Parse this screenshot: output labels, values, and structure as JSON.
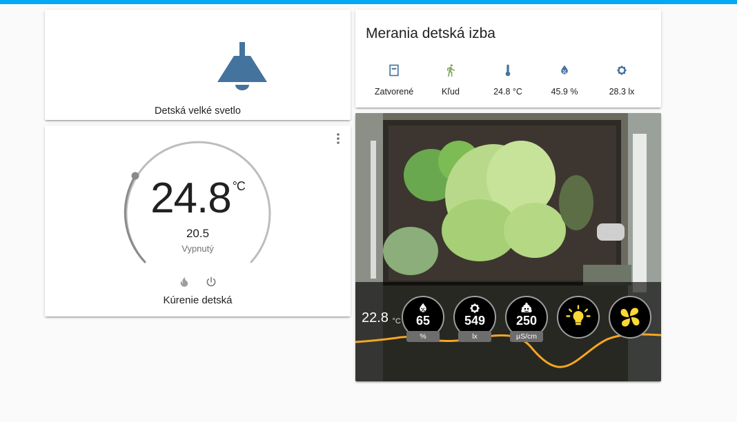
{
  "colors": {
    "accent": "#03a9f4",
    "icon_blue": "#44739e",
    "plant_orange": "#f5a623"
  },
  "light": {
    "name": "Detská velké svetlo",
    "icon": "ceiling-lamp-icon"
  },
  "thermostat": {
    "current": "24.8",
    "unit": "°C",
    "target": "20.5",
    "mode": "Vypnutý",
    "name": "Kúrenie detská",
    "menu_icon": "dots-vertical-icon",
    "controls": [
      "fire-icon",
      "power-icon"
    ]
  },
  "measurements": {
    "title": "Merania detská izba",
    "items": [
      {
        "icon": "door-closed-icon",
        "value": "Zatvorené"
      },
      {
        "icon": "walk-icon",
        "value": "Kľud"
      },
      {
        "icon": "thermometer-icon",
        "value": "24.8 °C"
      },
      {
        "icon": "water-percent-icon",
        "value": "45.9 %"
      },
      {
        "icon": "brightness-icon",
        "value": "28.3 lx"
      }
    ]
  },
  "plant": {
    "temperature": "22.8",
    "temperature_unit": "°C",
    "gauges": [
      {
        "icon": "water-percent-icon",
        "value": "65",
        "unit": "%"
      },
      {
        "icon": "brightness-icon",
        "value": "549",
        "unit": "lx"
      },
      {
        "icon": "emoticon-poop-icon",
        "value": "250",
        "unit": "µS/cm"
      }
    ],
    "buttons": [
      {
        "icon": "lightbulb-icon"
      },
      {
        "icon": "fan-icon"
      }
    ]
  }
}
